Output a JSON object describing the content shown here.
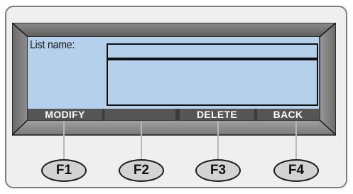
{
  "screen": {
    "list_name_label": "List name:",
    "list_name_value": ""
  },
  "softkeys": [
    {
      "label": "MODIFY"
    },
    {
      "label": ""
    },
    {
      "label": "DELETE"
    },
    {
      "label": "BACK"
    }
  ],
  "function_keys": [
    {
      "label": "F1"
    },
    {
      "label": "F2"
    },
    {
      "label": "F3"
    },
    {
      "label": "F4"
    }
  ],
  "colors": {
    "screen_background": "#b4d0ea",
    "softkey_bar": "#555555",
    "panel_background": "#efefef",
    "button_fill": "#d3d3d3"
  }
}
